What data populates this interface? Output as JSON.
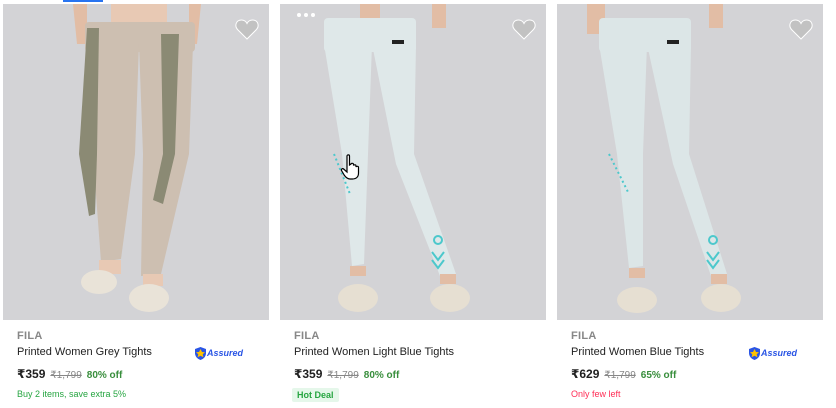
{
  "products": [
    {
      "brand": "FILA",
      "title": "Printed Women Grey Tights",
      "price": "₹359",
      "mrp": "₹1,799",
      "discount": "80% off",
      "offer": "Buy 2 items, save extra 5%",
      "assured": true,
      "assured_label": "Assured",
      "tights_color": "#cdbfb1",
      "panel_color": "#8b8a74"
    },
    {
      "brand": "FILA",
      "title": "Printed Women Light Blue Tights",
      "price": "₹359",
      "mrp": "₹1,799",
      "discount": "80% off",
      "deal_badge": "Hot Deal",
      "assured": false,
      "tights_color": "#dfe8e9",
      "accent_color": "#4cc8cc"
    },
    {
      "brand": "FILA",
      "title": "Printed Women Blue Tights",
      "price": "₹629",
      "mrp": "₹1,799",
      "discount": "65% off",
      "stock_note": "Only few left",
      "assured": true,
      "assured_label": "Assured",
      "tights_color": "#dce6e7",
      "accent_color": "#4cc8cc"
    }
  ],
  "icons": {
    "wishlist": "heart-icon",
    "assured": "shield-icon",
    "more": "dots-icon",
    "cursor": "hand-cursor-icon"
  },
  "colors": {
    "image_bg": "#d3d3d6",
    "discount_green": "#388e3c",
    "offer_green": "#26a541",
    "few_left_red": "#ff2d55",
    "assured_blue": "#2a55e5"
  }
}
